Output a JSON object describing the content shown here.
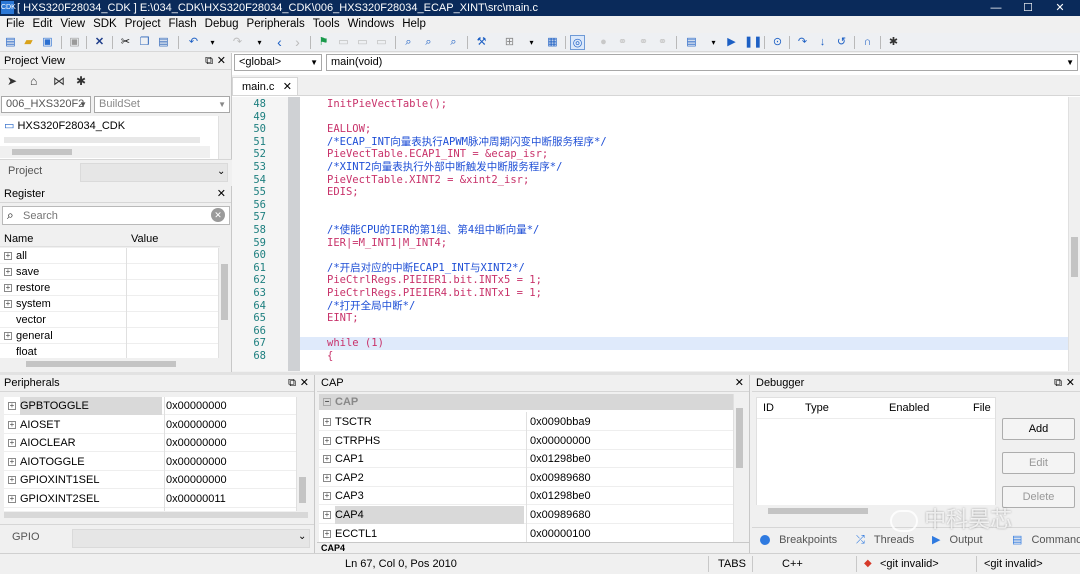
{
  "window": {
    "title": "[ HXS320F28034_CDK ] E:\\034_CDK\\HXS320F28034_CDK\\006_HXS320F28034_ECAP_XINT\\src\\main.c",
    "icon": "app-icon",
    "controls": [
      "minimize-icon",
      "maximize-icon",
      "close-icon"
    ]
  },
  "menu": [
    "File",
    "Edit",
    "View",
    "SDK",
    "Project",
    "Flash",
    "Debug",
    "Peripherals",
    "Tools",
    "Windows",
    "Help"
  ],
  "project_view": {
    "title": "Project View",
    "project_select": "006_HXS320F2",
    "buildset": "BuildSet",
    "tree_root": "HXS320F28034_CDK",
    "project_tab": "Project"
  },
  "register": {
    "title": "Register",
    "search_placeholder": "Search",
    "col_name": "Name",
    "col_value": "Value",
    "rows": [
      "all",
      "save",
      "restore",
      "system",
      "vector",
      "general",
      "float"
    ]
  },
  "editor": {
    "scope_select": "<global>",
    "function_select": "main(void)",
    "tab": "main.c",
    "first_line": 48,
    "current_line": 67,
    "lines": [
      "InitPieVectTable();",
      "",
      "EALLOW;",
      "/*ECAP_INT向量表执行APWM脉冲周期闪变中断服务程序*/",
      "PieVectTable.ECAP1_INT = &ecap_isr;",
      "/*XINT2向量表执行外部中断触发中断服务程序*/",
      "PieVectTable.XINT2 = &xint2_isr;",
      "EDIS;",
      "",
      "",
      "/*使能CPU的IER的第1组、第4组中断向量*/",
      "IER|=M_INT1|M_INT4;",
      "",
      "/*开启对应的中断ECAP1_INT与XINT2*/",
      "PieCtrlRegs.PIEIER1.bit.INTx5 = 1;",
      "PieCtrlRegs.PIEIER4.bit.INTx1 = 1;",
      "/*打开全局中断*/",
      "EINT;",
      "",
      "while (1)",
      "{"
    ]
  },
  "peripherals": {
    "title": "Peripherals",
    "rows": [
      {
        "name": "GPBTOGGLE",
        "value": "0x00000000"
      },
      {
        "name": "AIOSET",
        "value": "0x00000000"
      },
      {
        "name": "AIOCLEAR",
        "value": "0x00000000"
      },
      {
        "name": "AIOTOGGLE",
        "value": "0x00000000"
      },
      {
        "name": "GPIOXINT1SEL",
        "value": "0x00000000"
      },
      {
        "name": "GPIOXINT2SEL",
        "value": "0x00000011"
      }
    ],
    "bottom_tab": "GPIO"
  },
  "cap": {
    "title": "CAP",
    "group": "CAP",
    "rows": [
      {
        "name": "TSCTR",
        "value": "0x0090bba9"
      },
      {
        "name": "CTRPHS",
        "value": "0x00000000"
      },
      {
        "name": "CAP1",
        "value": "0x01298be0"
      },
      {
        "name": "CAP2",
        "value": "0x00989680"
      },
      {
        "name": "CAP3",
        "value": "0x01298be0"
      },
      {
        "name": "CAP4",
        "value": "0x00989680"
      },
      {
        "name": "ECCTL1",
        "value": "0x00000100"
      }
    ],
    "bottom_tab": "CAP4"
  },
  "debugger": {
    "title": "Debugger",
    "cols": [
      "ID",
      "Type",
      "Enabled",
      "File"
    ],
    "buttons": [
      "Add",
      "Edit",
      "Delete"
    ],
    "tabs": [
      "Breakpoints",
      "Threads",
      "Output",
      "Command"
    ]
  },
  "status": {
    "position": "Ln 67, Col 0, Pos 2010",
    "tabs": "TABS",
    "lang": "C++",
    "git1": "<git invalid>",
    "git2": "<git invalid>"
  },
  "watermark": "中科昊芯",
  "colors": {
    "titlebar": "#0a2a5a",
    "code_text": "#c8326a",
    "comment_text": "#1f4fd6",
    "line_number": "#1d7f7f",
    "current_line_bg": "#dfeafb"
  }
}
